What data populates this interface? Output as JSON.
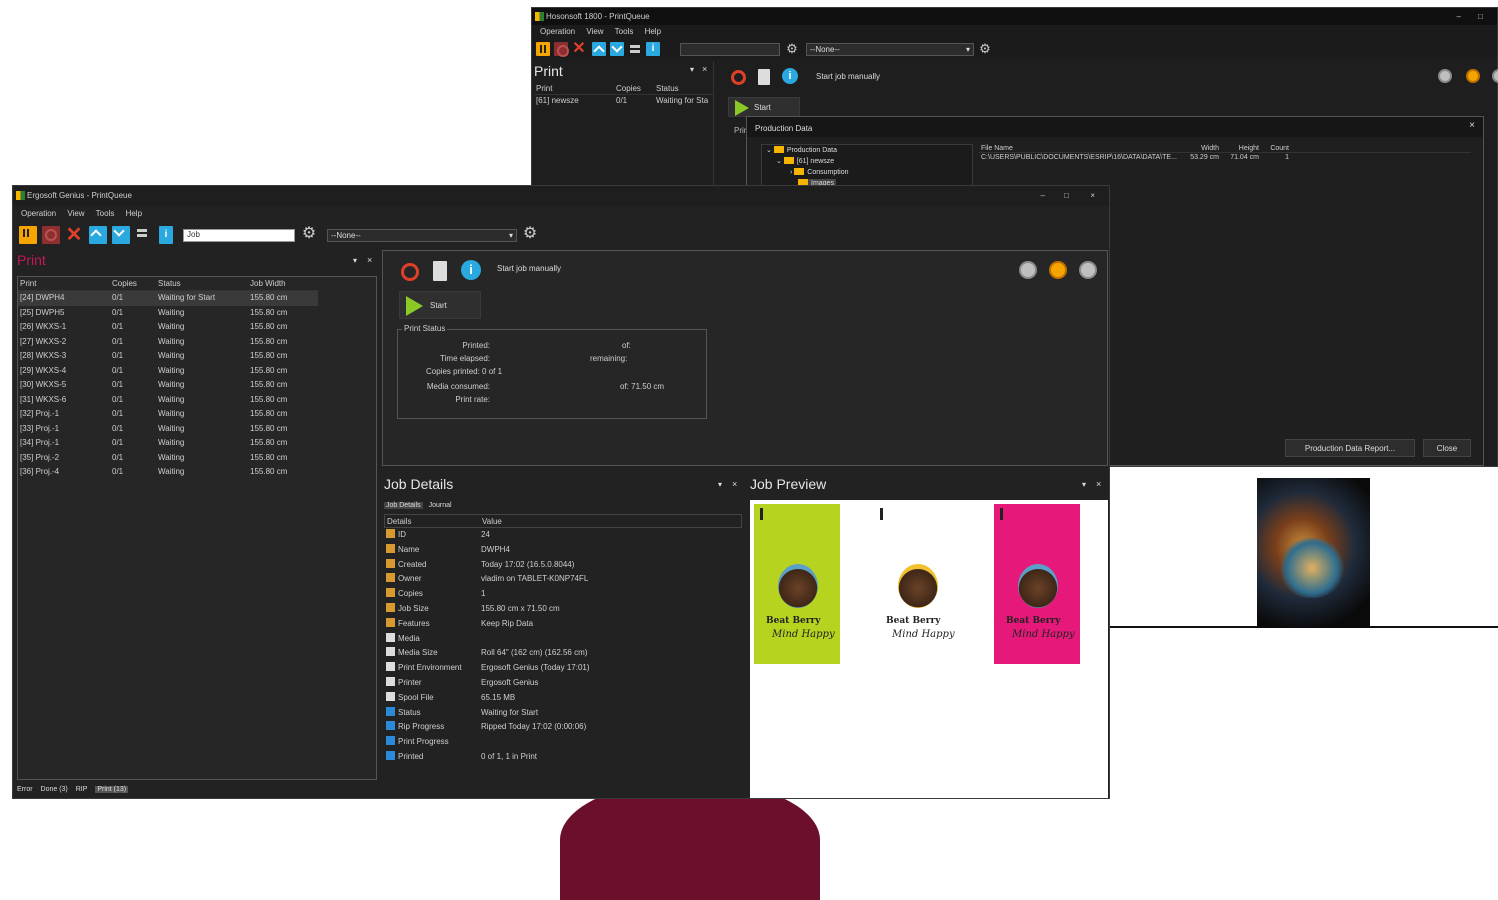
{
  "back_window": {
    "title": "Hosonsoft 1800 - PrintQueue",
    "window_controls": [
      "–",
      "□"
    ],
    "menu": [
      "Operation",
      "View",
      "Tools",
      "Help"
    ],
    "filter_combo": "--None--",
    "panel_title": "Print",
    "panel_controls": [
      "▾",
      "×"
    ],
    "columns": [
      "Print",
      "Copies",
      "Status"
    ],
    "rows": [
      {
        "print": "[61] newsze",
        "copies": "0/1",
        "status": "Waiting for Sta"
      }
    ],
    "start_job_label": "Start job manually",
    "start_button": "Start",
    "print_status_label": "Prin",
    "production_dialog": {
      "title": "Production Data",
      "close": "×",
      "tree": [
        "Production Data",
        "[61] newsze",
        "Consumption",
        "Images"
      ],
      "columns": [
        "File Name",
        "Width",
        "Height",
        "Count"
      ],
      "rows": [
        {
          "file": "C:\\USERS\\PUBLIC\\DOCUMENTS\\ESRIP\\16\\DATA\\DATA\\TE...",
          "width": "53.29 cm",
          "height": "71.04 cm",
          "count": "1"
        }
      ],
      "report_button": "Production Data Report...",
      "close_button": "Close"
    }
  },
  "front_window": {
    "title": "Ergosoft Genius - PrintQueue",
    "window_controls": [
      "–",
      "□",
      "×"
    ],
    "menu": [
      "Operation",
      "View",
      "Tools",
      "Help"
    ],
    "search_value": "Job",
    "filter_combo": "--None--",
    "print_panel": {
      "title": "Print",
      "controls": [
        "▾",
        "×"
      ],
      "columns": [
        "Print",
        "Copies",
        "Status",
        "Job Width"
      ],
      "rows": [
        {
          "print": "[24] DWPH4",
          "copies": "0/1",
          "status": "Waiting for Start",
          "width": "155.80 cm"
        },
        {
          "print": "[25] DWPH5",
          "copies": "0/1",
          "status": "Waiting",
          "width": "155.80 cm"
        },
        {
          "print": "[26] WKXS-1",
          "copies": "0/1",
          "status": "Waiting",
          "width": "155.80 cm"
        },
        {
          "print": "[27] WKXS-2",
          "copies": "0/1",
          "status": "Waiting",
          "width": "155.80 cm"
        },
        {
          "print": "[28] WKXS-3",
          "copies": "0/1",
          "status": "Waiting",
          "width": "155.80 cm"
        },
        {
          "print": "[29] WKXS-4",
          "copies": "0/1",
          "status": "Waiting",
          "width": "155.80 cm"
        },
        {
          "print": "[30] WKXS-5",
          "copies": "0/1",
          "status": "Waiting",
          "width": "155.80 cm"
        },
        {
          "print": "[31] WKXS-6",
          "copies": "0/1",
          "status": "Waiting",
          "width": "155.80 cm"
        },
        {
          "print": "[32] Proj.-1",
          "copies": "0/1",
          "status": "Waiting",
          "width": "155.80 cm"
        },
        {
          "print": "[33] Proj.-1",
          "copies": "0/1",
          "status": "Waiting",
          "width": "155.80 cm"
        },
        {
          "print": "[34] Proj.-1",
          "copies": "0/1",
          "status": "Waiting",
          "width": "155.80 cm"
        },
        {
          "print": "[35] Proj.-2",
          "copies": "0/1",
          "status": "Waiting",
          "width": "155.80 cm"
        },
        {
          "print": "[36] Proj.-4",
          "copies": "0/1",
          "status": "Waiting",
          "width": "155.80 cm"
        }
      ],
      "status_tabs": [
        "Error",
        "Done (3)",
        "RIP",
        "Print (13)"
      ]
    },
    "control_panel": {
      "start_job_label": "Start job manually",
      "start_button": "Start",
      "print_status": {
        "title": "Print Status",
        "printed_label": "Printed:",
        "of_label": "of:",
        "time_label": "Time elapsed:",
        "remaining_label": "remaining:",
        "copies_label": "Copies printed: 0 of 1",
        "media_label": "Media consumed:",
        "media_of": "of: 71.50 cm",
        "rate_label": "Print rate:"
      }
    },
    "job_details": {
      "title": "Job Details",
      "controls": [
        "▾",
        "×"
      ],
      "tabs": [
        "Job Details",
        "Journal"
      ],
      "columns": [
        "Details",
        "Value"
      ],
      "rows": [
        {
          "icon": "doc",
          "key": "ID",
          "value": "24"
        },
        {
          "icon": "doc",
          "key": "Name",
          "value": "DWPH4"
        },
        {
          "icon": "doc",
          "key": "Created",
          "value": "Today 17:02 (16.5.0.8044)"
        },
        {
          "icon": "doc",
          "key": "Owner",
          "value": "vladim on TABLET-K0NP74FL"
        },
        {
          "icon": "doc",
          "key": "Copies",
          "value": "1"
        },
        {
          "icon": "doc",
          "key": "Job Size",
          "value": "155.80 cm x 71.50 cm"
        },
        {
          "icon": "doc",
          "key": "Features",
          "value": "Keep Rip Data"
        },
        {
          "icon": "lines",
          "key": "Media",
          "value": ""
        },
        {
          "icon": "lines",
          "key": "Media Size",
          "value": "Roll 64\" (162 cm) (162.56 cm)"
        },
        {
          "icon": "lines",
          "key": "Print Environment",
          "value": "Ergosoft Genius (Today 17:01)"
        },
        {
          "icon": "lines",
          "key": "Printer",
          "value": "Ergosoft Genius"
        },
        {
          "icon": "lines",
          "key": "Spool File",
          "value": "65.15 MB"
        },
        {
          "icon": "info",
          "key": "Status",
          "value": "Waiting for Start"
        },
        {
          "icon": "info",
          "key": "Rip Progress",
          "value": "Ripped Today 17:02 (0:00:06)"
        },
        {
          "icon": "info",
          "key": "Print Progress",
          "value": ""
        },
        {
          "icon": "info",
          "key": "Printed",
          "value": "0 of 1, 1 in Print"
        }
      ]
    },
    "job_preview": {
      "title": "Job Preview",
      "controls": [
        "▾",
        "×"
      ],
      "posters": [
        {
          "bg": "#b6d41f",
          "line1": "Beat Berry",
          "line2": "Mind Happy"
        },
        {
          "bg": "#ffffff",
          "line1": "Beat Berry",
          "line2": "Mind Happy"
        },
        {
          "bg": "#e6197a",
          "line1": "Beat Berry",
          "line2": "Mind Happy"
        }
      ]
    }
  },
  "colors": {
    "accent_orange": "#f5a400",
    "accent_blue": "#2aa8e0",
    "play_green": "#8ac926",
    "print_title_pink": "#c2185b",
    "decor_maroon": "#6b0f2a"
  }
}
